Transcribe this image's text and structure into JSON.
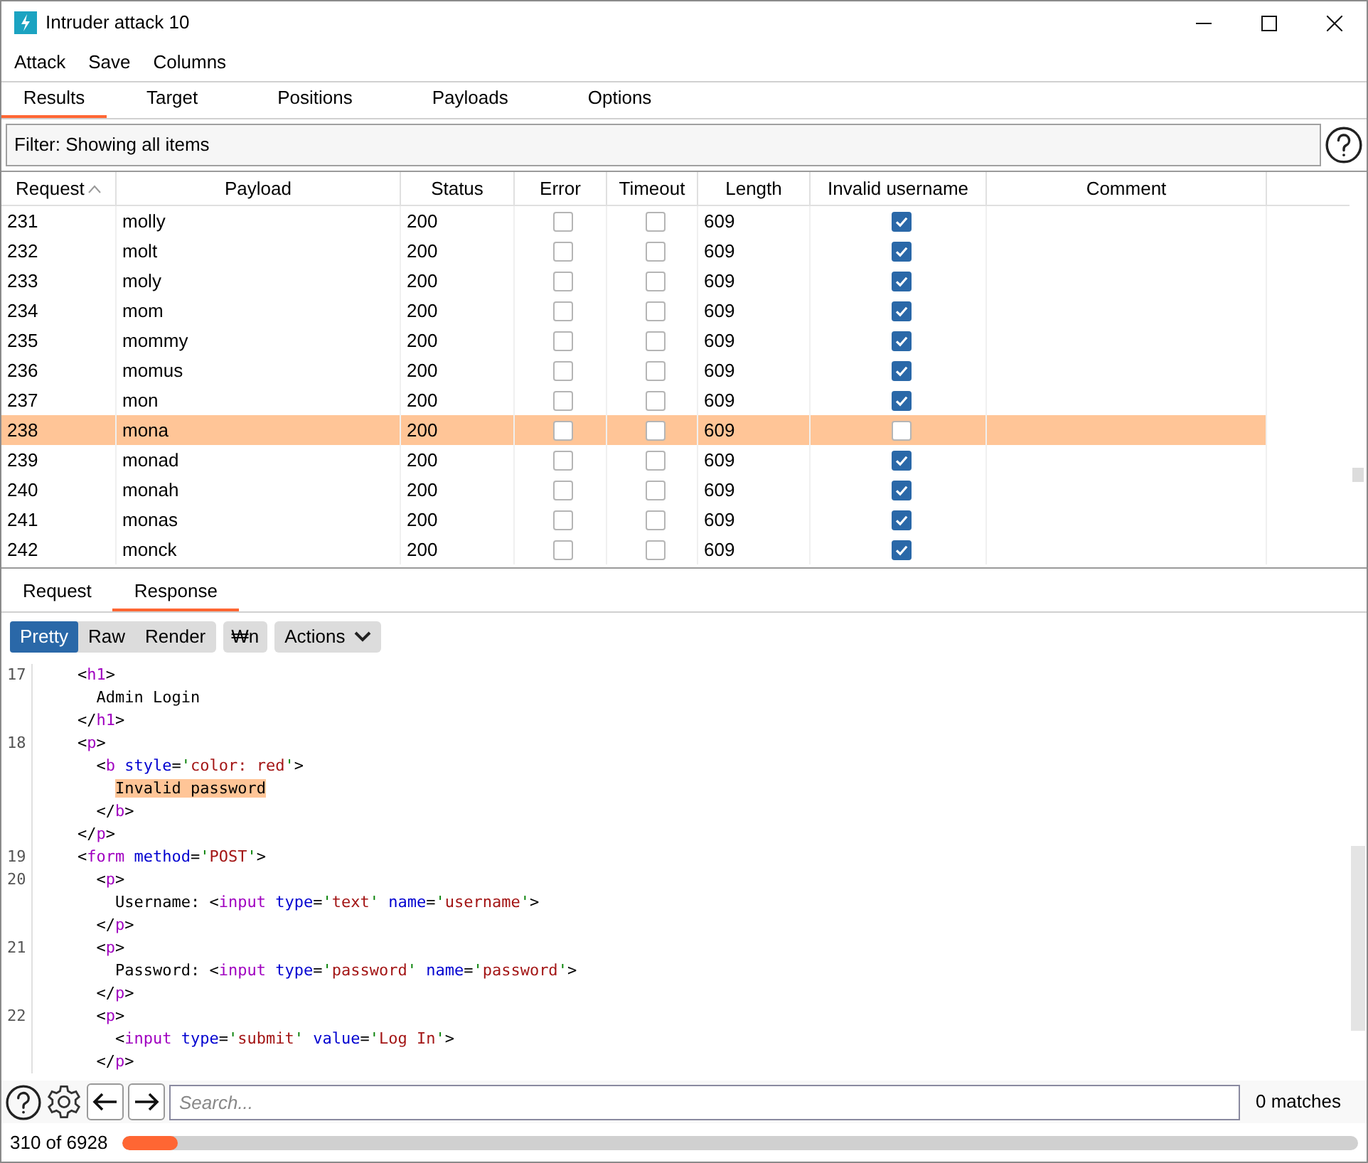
{
  "window": {
    "title": "Intruder attack 10"
  },
  "menu": [
    "Attack",
    "Save",
    "Columns"
  ],
  "tabs": [
    {
      "label": "Results",
      "selected": true
    },
    {
      "label": "Target",
      "selected": false
    },
    {
      "label": "Positions",
      "selected": false
    },
    {
      "label": "Payloads",
      "selected": false
    },
    {
      "label": "Options",
      "selected": false
    }
  ],
  "filter": "Filter: Showing all items",
  "table": {
    "columns": [
      "Request",
      "Payload",
      "Status",
      "Error",
      "Timeout",
      "Length",
      "Invalid username",
      "Comment"
    ],
    "rows": [
      {
        "request": "231",
        "payload": "molly",
        "status": "200",
        "error": false,
        "timeout": false,
        "length": "609",
        "invalid_username": true,
        "selected": false
      },
      {
        "request": "232",
        "payload": "molt",
        "status": "200",
        "error": false,
        "timeout": false,
        "length": "609",
        "invalid_username": true,
        "selected": false
      },
      {
        "request": "233",
        "payload": "moly",
        "status": "200",
        "error": false,
        "timeout": false,
        "length": "609",
        "invalid_username": true,
        "selected": false
      },
      {
        "request": "234",
        "payload": "mom",
        "status": "200",
        "error": false,
        "timeout": false,
        "length": "609",
        "invalid_username": true,
        "selected": false
      },
      {
        "request": "235",
        "payload": "mommy",
        "status": "200",
        "error": false,
        "timeout": false,
        "length": "609",
        "invalid_username": true,
        "selected": false
      },
      {
        "request": "236",
        "payload": "momus",
        "status": "200",
        "error": false,
        "timeout": false,
        "length": "609",
        "invalid_username": true,
        "selected": false
      },
      {
        "request": "237",
        "payload": "mon",
        "status": "200",
        "error": false,
        "timeout": false,
        "length": "609",
        "invalid_username": true,
        "selected": false
      },
      {
        "request": "238",
        "payload": "mona",
        "status": "200",
        "error": false,
        "timeout": false,
        "length": "609",
        "invalid_username": false,
        "selected": true
      },
      {
        "request": "239",
        "payload": "monad",
        "status": "200",
        "error": false,
        "timeout": false,
        "length": "609",
        "invalid_username": true,
        "selected": false
      },
      {
        "request": "240",
        "payload": "monah",
        "status": "200",
        "error": false,
        "timeout": false,
        "length": "609",
        "invalid_username": true,
        "selected": false
      },
      {
        "request": "241",
        "payload": "monas",
        "status": "200",
        "error": false,
        "timeout": false,
        "length": "609",
        "invalid_username": true,
        "selected": false
      },
      {
        "request": "242",
        "payload": "monck",
        "status": "200",
        "error": false,
        "timeout": false,
        "length": "609",
        "invalid_username": true,
        "selected": false
      }
    ]
  },
  "detail_tabs": [
    {
      "label": "Request",
      "selected": false
    },
    {
      "label": "Response",
      "selected": true
    }
  ],
  "view_modes": [
    {
      "label": "Pretty",
      "selected": true
    },
    {
      "label": "Raw",
      "selected": false
    },
    {
      "label": "Render",
      "selected": false
    }
  ],
  "newline_button": "₩n",
  "actions_button": "Actions",
  "code": [
    {
      "number": "17",
      "tokens": [
        {
          "kind": "punct",
          "text": "    <"
        },
        {
          "kind": "tag",
          "text": "h1"
        },
        {
          "kind": "punct",
          "text": ">"
        }
      ]
    },
    {
      "tokens": [
        {
          "kind": "text",
          "text": "      Admin Login"
        }
      ]
    },
    {
      "tokens": [
        {
          "kind": "punct",
          "text": "    </"
        },
        {
          "kind": "tag",
          "text": "h1"
        },
        {
          "kind": "punct",
          "text": ">"
        }
      ]
    },
    {
      "number": "18",
      "tokens": [
        {
          "kind": "punct",
          "text": "    <"
        },
        {
          "kind": "tag",
          "text": "p"
        },
        {
          "kind": "punct",
          "text": ">"
        }
      ]
    },
    {
      "tokens": [
        {
          "kind": "punct",
          "text": "      <"
        },
        {
          "kind": "tag",
          "text": "b"
        },
        {
          "kind": "attr",
          "text": " style"
        },
        {
          "kind": "punct",
          "text": "="
        },
        {
          "kind": "quote",
          "text": "'"
        },
        {
          "kind": "value",
          "text": "color: red"
        },
        {
          "kind": "quote",
          "text": "'"
        },
        {
          "kind": "punct",
          "text": ">"
        }
      ]
    },
    {
      "tokens": [
        {
          "kind": "highlight",
          "text": "Invalid password"
        }
      ]
    },
    {
      "tokens": [
        {
          "kind": "punct",
          "text": "      </"
        },
        {
          "kind": "tag",
          "text": "b"
        },
        {
          "kind": "punct",
          "text": ">"
        }
      ]
    },
    {
      "tokens": [
        {
          "kind": "punct",
          "text": "    </"
        },
        {
          "kind": "tag",
          "text": "p"
        },
        {
          "kind": "punct",
          "text": ">"
        }
      ]
    },
    {
      "number": "19",
      "tokens": [
        {
          "kind": "punct",
          "text": "    <"
        },
        {
          "kind": "tag",
          "text": "form"
        },
        {
          "kind": "attr",
          "text": " method"
        },
        {
          "kind": "punct",
          "text": "="
        },
        {
          "kind": "quote",
          "text": "'"
        },
        {
          "kind": "value",
          "text": "POST"
        },
        {
          "kind": "quote",
          "text": "'"
        },
        {
          "kind": "punct",
          "text": ">"
        }
      ]
    },
    {
      "number": "20",
      "tokens": [
        {
          "kind": "punct",
          "text": "      <"
        },
        {
          "kind": "tag",
          "text": "p"
        },
        {
          "kind": "punct",
          "text": ">"
        }
      ]
    },
    {
      "tokens": [
        {
          "kind": "text",
          "text": "        Username: "
        },
        {
          "kind": "punct",
          "text": "<"
        },
        {
          "kind": "tag",
          "text": "input"
        },
        {
          "kind": "attr",
          "text": " type"
        },
        {
          "kind": "punct",
          "text": "="
        },
        {
          "kind": "quote",
          "text": "'"
        },
        {
          "kind": "value",
          "text": "text"
        },
        {
          "kind": "quote",
          "text": "'"
        },
        {
          "kind": "attr",
          "text": " name"
        },
        {
          "kind": "punct",
          "text": "="
        },
        {
          "kind": "quote",
          "text": "'"
        },
        {
          "kind": "value",
          "text": "username"
        },
        {
          "kind": "quote",
          "text": "'"
        },
        {
          "kind": "punct",
          "text": ">"
        }
      ]
    },
    {
      "tokens": [
        {
          "kind": "punct",
          "text": "      </"
        },
        {
          "kind": "tag",
          "text": "p"
        },
        {
          "kind": "punct",
          "text": ">"
        }
      ]
    },
    {
      "number": "21",
      "tokens": [
        {
          "kind": "punct",
          "text": "      <"
        },
        {
          "kind": "tag",
          "text": "p"
        },
        {
          "kind": "punct",
          "text": ">"
        }
      ]
    },
    {
      "tokens": [
        {
          "kind": "text",
          "text": "        Password: "
        },
        {
          "kind": "punct",
          "text": "<"
        },
        {
          "kind": "tag",
          "text": "input"
        },
        {
          "kind": "attr",
          "text": " type"
        },
        {
          "kind": "punct",
          "text": "="
        },
        {
          "kind": "quote",
          "text": "'"
        },
        {
          "kind": "value",
          "text": "password"
        },
        {
          "kind": "quote",
          "text": "'"
        },
        {
          "kind": "attr",
          "text": " name"
        },
        {
          "kind": "punct",
          "text": "="
        },
        {
          "kind": "quote",
          "text": "'"
        },
        {
          "kind": "value",
          "text": "password"
        },
        {
          "kind": "quote",
          "text": "'"
        },
        {
          "kind": "punct",
          "text": ">"
        }
      ]
    },
    {
      "tokens": [
        {
          "kind": "punct",
          "text": "      </"
        },
        {
          "kind": "tag",
          "text": "p"
        },
        {
          "kind": "punct",
          "text": ">"
        }
      ]
    },
    {
      "number": "22",
      "tokens": [
        {
          "kind": "punct",
          "text": "      <"
        },
        {
          "kind": "tag",
          "text": "p"
        },
        {
          "kind": "punct",
          "text": ">"
        }
      ]
    },
    {
      "tokens": [
        {
          "kind": "punct",
          "text": "        <"
        },
        {
          "kind": "tag",
          "text": "input"
        },
        {
          "kind": "attr",
          "text": " type"
        },
        {
          "kind": "punct",
          "text": "="
        },
        {
          "kind": "quote",
          "text": "'"
        },
        {
          "kind": "value",
          "text": "submit"
        },
        {
          "kind": "quote",
          "text": "'"
        },
        {
          "kind": "attr",
          "text": " value"
        },
        {
          "kind": "punct",
          "text": "="
        },
        {
          "kind": "quote",
          "text": "'"
        },
        {
          "kind": "value",
          "text": "Log In"
        },
        {
          "kind": "quote",
          "text": "'"
        },
        {
          "kind": "punct",
          "text": ">"
        }
      ]
    },
    {
      "tokens": [
        {
          "kind": "punct",
          "text": "      </"
        },
        {
          "kind": "tag",
          "text": "p"
        },
        {
          "kind": "punct",
          "text": ">"
        }
      ]
    }
  ],
  "search": {
    "placeholder": "Search...",
    "matches": "0 matches"
  },
  "status_bar": {
    "progress_text": "310 of 6928",
    "level": 0.045
  }
}
